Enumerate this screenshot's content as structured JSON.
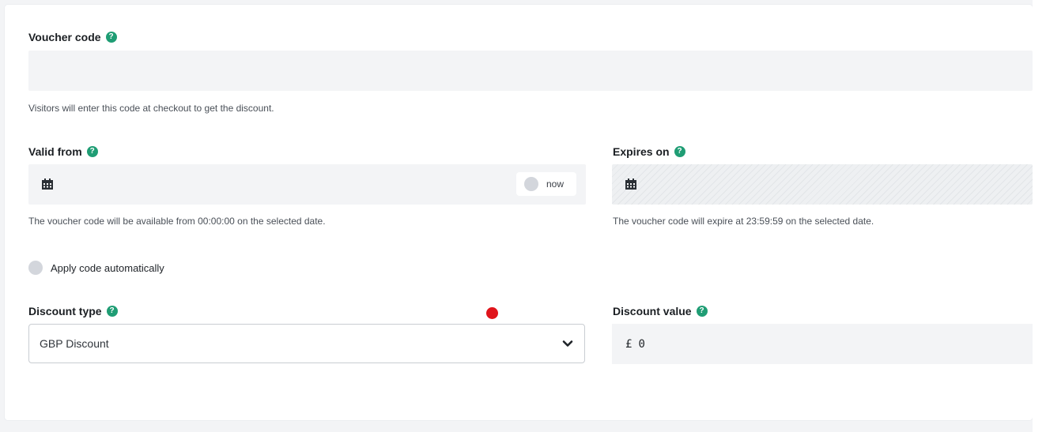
{
  "voucher_code": {
    "label": "Voucher code",
    "value": "",
    "hint": "Visitors will enter this code at checkout to get the discount."
  },
  "valid_from": {
    "label": "Valid from",
    "value": "",
    "now_label": "now",
    "hint": "The voucher code will be available from 00:00:00 on the selected date."
  },
  "expires_on": {
    "label": "Expires on",
    "value": "",
    "hint": "The voucher code will expire at 23:59:59 on the selected date."
  },
  "apply_auto": {
    "label": "Apply code automatically",
    "checked": false
  },
  "discount_type": {
    "label": "Discount type",
    "selected": "GBP Discount"
  },
  "discount_value": {
    "label": "Discount value",
    "currency_symbol": "£",
    "value": "0"
  },
  "colors": {
    "help_icon": "#1f9d74",
    "marker": "#e0141b",
    "field_bg": "#f3f4f6"
  },
  "icons": {
    "help": "help-icon",
    "calendar": "calendar-icon",
    "chevron": "chevron-down-icon"
  }
}
